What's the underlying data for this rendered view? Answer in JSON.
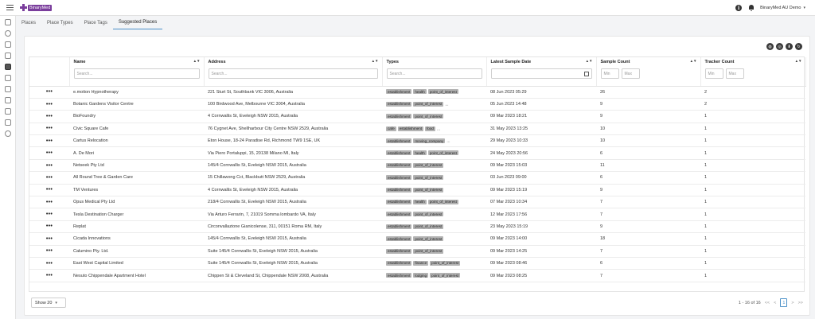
{
  "app": {
    "logo_text": "BinaryMed",
    "account": "BinaryMed AU Demo"
  },
  "tabs": [
    "Places",
    "Place Types",
    "Place Tags",
    "Suggested Places"
  ],
  "active_tab": 3,
  "columns": {
    "name": "Name",
    "address": "Address",
    "types": "Types",
    "latest": "Latest Sample Date",
    "samples": "Sample Count",
    "trackers": "Tracker Count"
  },
  "filters": {
    "search_placeholder": "Search...",
    "min_placeholder": "Min",
    "max_placeholder": "Max"
  },
  "rows": [
    {
      "name": "e.motion Hypnotherapy",
      "address": "221 Sturt St, Southbank VIC 3006, Australia",
      "types": [
        "establishment",
        "health",
        "point_of_interest"
      ],
      "more": false,
      "date": "08 Jun 2023 05:29",
      "samples": "26",
      "trackers": "2"
    },
    {
      "name": "Botanic Gardens Visitor Centre",
      "address": "100 Birdwood Ave, Melbourne VIC 3004, Australia",
      "types": [
        "establishment",
        "point_of_interest"
      ],
      "more": true,
      "date": "05 Jun 2023 14:48",
      "samples": "9",
      "trackers": "2"
    },
    {
      "name": "BioFoundry",
      "address": "4 Cornwallis St, Eveleigh NSW 2015, Australia",
      "types": [
        "establishment",
        "point_of_interest"
      ],
      "more": false,
      "date": "09 Mar 2023 18:21",
      "samples": "9",
      "trackers": "1"
    },
    {
      "name": "Civic Square Cafe",
      "address": "76 Cygnet Ave, Shellharbour City Centre NSW 2529, Australia",
      "types": [
        "cafe",
        "establishment",
        "food"
      ],
      "more": true,
      "date": "31 May 2023 13:25",
      "samples": "10",
      "trackers": "1"
    },
    {
      "name": "Cartus Relocation",
      "address": "Eton House, 18-24 Paradise Rd, Richmond TW9 1SE, UK",
      "types": [
        "establishment",
        "moving_company"
      ],
      "more": true,
      "date": "29 May 2023 10:33",
      "samples": "10",
      "trackers": "1"
    },
    {
      "name": "A. De Mori",
      "address": "Via Piero Portaluppi, 15, 20138 Milano MI, Italy",
      "types": [
        "establishment",
        "health",
        "point_of_interest"
      ],
      "more": false,
      "date": "24 May 2023 20:56",
      "samples": "6",
      "trackers": "1"
    },
    {
      "name": "Netseek Pty Ltd",
      "address": "145/4 Cornwallis St, Eveleigh NSW 2015, Australia",
      "types": [
        "establishment",
        "point_of_interest"
      ],
      "more": false,
      "date": "09 Mar 2023 15:03",
      "samples": "11",
      "trackers": "1"
    },
    {
      "name": "All Round Tree & Garden Care",
      "address": "15 Chillawong Cct, Blackbutt NSW 2529, Australia",
      "types": [
        "establishment",
        "point_of_interest"
      ],
      "more": false,
      "date": "03 Jun 2023 09:00",
      "samples": "6",
      "trackers": "1"
    },
    {
      "name": "TM Ventures",
      "address": "4 Cornwallis St, Eveleigh NSW 2015, Australia",
      "types": [
        "establishment",
        "point_of_interest"
      ],
      "more": false,
      "date": "09 Mar 2023 15:19",
      "samples": "9",
      "trackers": "1"
    },
    {
      "name": "Opus Medical Pty Ltd",
      "address": "218/4 Cornwallis St, Eveleigh NSW 2015, Australia",
      "types": [
        "establishment",
        "health",
        "point_of_interest"
      ],
      "more": false,
      "date": "07 Mar 2023 10:34",
      "samples": "7",
      "trackers": "1"
    },
    {
      "name": "Tesla Destination Charger",
      "address": "Via Arturo Ferrarin, 7, 21019 Somma lombardo VA, Italy",
      "types": [
        "establishment",
        "point_of_interest"
      ],
      "more": false,
      "date": "12 Mar 2023 17:56",
      "samples": "7",
      "trackers": "1"
    },
    {
      "name": "Replat",
      "address": "Circonvallazione Gianicolense, 311, 00151 Roma RM, Italy",
      "types": [
        "establishment",
        "point_of_interest"
      ],
      "more": false,
      "date": "23 May 2023 15:19",
      "samples": "9",
      "trackers": "1"
    },
    {
      "name": "Cicada Innovations",
      "address": "145/4 Cornwallis St, Eveleigh NSW 2015, Australia",
      "types": [
        "establishment",
        "point_of_interest"
      ],
      "more": false,
      "date": "09 Mar 2023 14:00",
      "samples": "18",
      "trackers": "1"
    },
    {
      "name": "Calumino Pty. Ltd.",
      "address": "Suite 145/4 Cornwallis St, Eveleigh NSW 2015, Australia",
      "types": [
        "establishment",
        "point_of_interest"
      ],
      "more": false,
      "date": "09 Mar 2023 14:25",
      "samples": "7",
      "trackers": "1"
    },
    {
      "name": "East West Capital Limited",
      "address": "Suite 145/4 Cornwallis St, Eveleigh NSW 2015, Australia",
      "types": [
        "establishment",
        "finance",
        "point_of_interest"
      ],
      "more": false,
      "date": "09 Mar 2023 08:46",
      "samples": "6",
      "trackers": "1"
    },
    {
      "name": "Nesuto Chippendale Apartment Hotel",
      "address": "Chippen St & Cleveland St, Chippendale NSW 2008, Australia",
      "types": [
        "establishment",
        "lodging",
        "point_of_interest"
      ],
      "more": false,
      "date": "09 Mar 2023 08:25",
      "samples": "7",
      "trackers": "1"
    }
  ],
  "footer": {
    "page_size": "Show 20",
    "range": "1 - 16 of 16",
    "first": "<<",
    "prev": "<",
    "current_page": "1",
    "next": ">",
    "last": ">>"
  }
}
